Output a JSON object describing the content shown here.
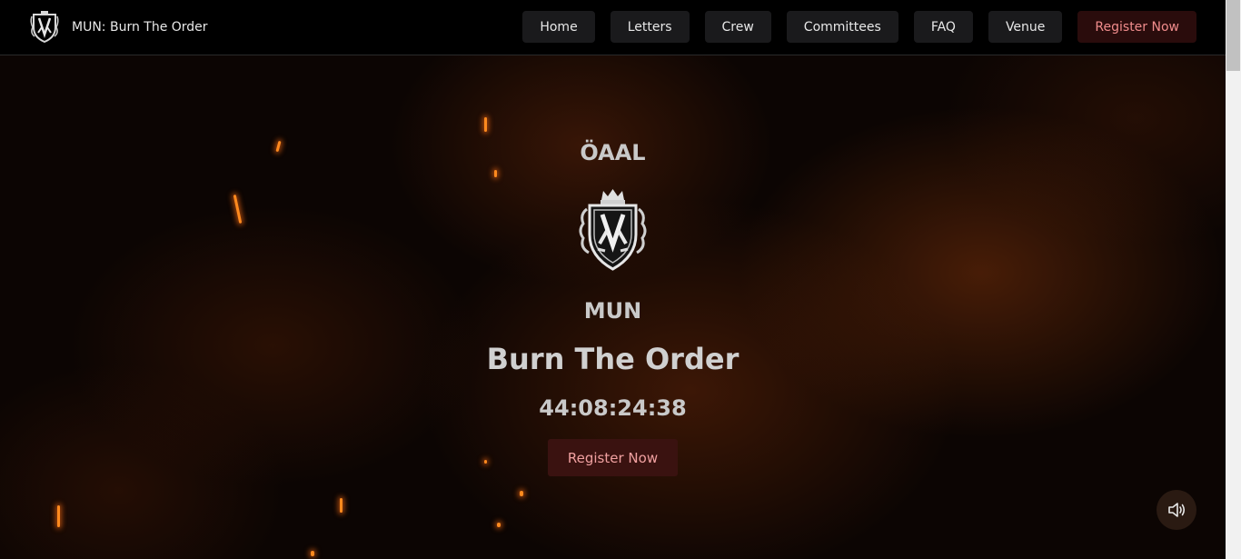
{
  "brand": {
    "title": "MUN: Burn The Order",
    "logo_icon": "crest-shield-icon"
  },
  "nav": {
    "items": [
      {
        "label": "Home"
      },
      {
        "label": "Letters"
      },
      {
        "label": "Crew"
      },
      {
        "label": "Committees"
      },
      {
        "label": "FAQ"
      },
      {
        "label": "Venue"
      }
    ],
    "register_label": "Register Now"
  },
  "hero": {
    "org": "ÖAAL",
    "crest_icon": "crest-shield-icon",
    "mun": "MUN",
    "title": "Burn The Order",
    "countdown": "44:08:24:38",
    "register_label": "Register Now"
  },
  "sound": {
    "icon": "speaker-volume-icon"
  },
  "colors": {
    "nav_bg": "#000000",
    "nav_button_bg": "#1a1a1c",
    "register_bg": "#2a0c0c",
    "register_text": "#f08c8c",
    "ember": "#ff8a1e"
  }
}
